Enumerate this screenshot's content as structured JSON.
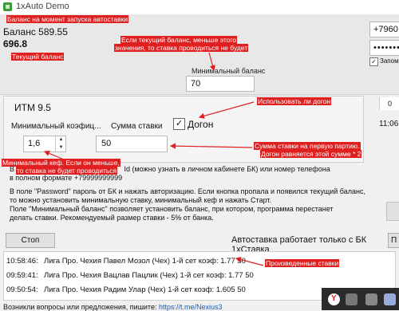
{
  "window": {
    "title": "1xAuto Demo"
  },
  "balance": {
    "label": "Баланс 589.55",
    "amount": "696.8"
  },
  "min_balance": {
    "label": "Минимальный баланс",
    "value": "70"
  },
  "login": {
    "phone": "+7960",
    "password": "••••••••",
    "remember_label": "Запомн",
    "remember_checked": "✓"
  },
  "match": {
    "title": "ИТМ 9.5",
    "min_coef_label": "Минимальный коэфиц...",
    "min_coef_value": "1,6",
    "stake_label": "Сумма ставки",
    "stake_value": "50",
    "dogon_label": "Догон",
    "dogon_checked": "✓"
  },
  "right_panel": {
    "counter": "0",
    "time": "11:06"
  },
  "info": {
    "line1_left": "В поле",
    "line1_right": "Id  (можно узнать в личном кабинете БК) или номер телефона",
    "line2": "в полном формате +79999999999",
    "line3": "В поле \"Password\" пароль от БК и нажать авторизацию. Если кнопка пропала и появился текущий баланс,",
    "line4": "то можно установить минимальную ставку, минимальный кеф и нажать Старт.",
    "line5": "Поле \"Минимальный баланс\" позволяет установить баланс, при котором, программа перестанет",
    "line6": "делать ставки. Рекомендуемый размер ставки - 5% от банка."
  },
  "controls": {
    "stop_label": "Стоп",
    "autobet_text": "Автоставка работает только с БК 1хСтавка",
    "right_btn_label": "П"
  },
  "log": [
    {
      "time": "10:58:46:",
      "text": "Лига Про. Чехия  Павел Мозол (Чех) 1-й сет  коэф: 1.77 50"
    },
    {
      "time": "09:59:41:",
      "text": "Лига Про. Чехия  Вацлав Пацлик (Чех) 1-й сет  коэф: 1.77 50"
    },
    {
      "time": "09:50:54:",
      "text": "Лига Про. Чехия  Радим Улар (Чех) 1-й сет  коэф: 1.605 50"
    }
  ],
  "footer": {
    "text": "Возникли вопросы или предложения, пишите: ",
    "link": "https://t.me/Nexius3"
  },
  "annotations": {
    "balance_start": "Баланс на момент запуска автоставки",
    "current_balance": "Текущий баланс",
    "min_balance_1": "Если текущий баланс, меньше этого",
    "min_balance_2": "значения, то ставка проводиться не будет",
    "dogon": "Использовать ли догон",
    "stake_1": "Сумма ставки на первую партию.",
    "stake_2": "Догон равняется этой сумме * 2",
    "min_coef_1": "Минимальный кеф. Если он меньше,",
    "min_coef_2": "то ставка не будет проводиться",
    "log": "Произведенные ставки"
  },
  "colors": {
    "annotation": "#e02020",
    "link": "#1a5bb8",
    "taskbar": "#2b2b2b"
  },
  "icons": [
    "app-icon",
    "spin-up-icon",
    "spin-down-icon",
    "checkbox-checked-icon",
    "yandex-browser-icon",
    "taskbar-app-icon"
  ]
}
